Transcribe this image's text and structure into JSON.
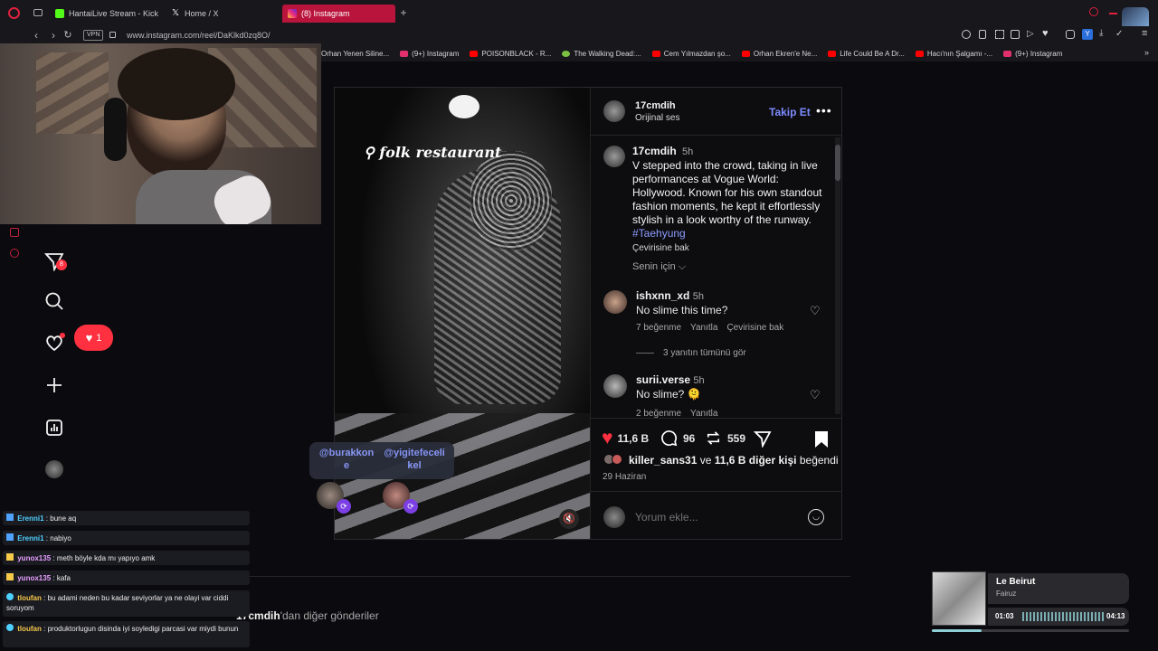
{
  "browser": {
    "tabs": [
      {
        "label": "HantaiLive Stream - Kick.D",
        "icon": "kick-icon",
        "color": "#53fc18"
      },
      {
        "label": "Home / X",
        "icon": "x-icon",
        "color": "#ffffff"
      },
      {
        "label": "(8) Instagram",
        "icon": "instagram-icon",
        "color": "#e1306c",
        "active": true
      }
    ],
    "url": "www.instagram.com/reel/DaKlkd0zq8O/",
    "vpn_label": "VPN",
    "accent": "#b9143c"
  },
  "bookmarks": [
    {
      "label": "Orhan Yenen Siline...",
      "color": ""
    },
    {
      "label": "(9+) Instagram",
      "color": "#e1306c"
    },
    {
      "label": "POISONBLACK - R...",
      "color": "#ff0000"
    },
    {
      "label": "The Walking Dead:...",
      "color": "#7ac143"
    },
    {
      "label": "Cem Yılmazdan şo...",
      "color": "#ff0000"
    },
    {
      "label": "Orhan Ekren'e Ne...",
      "color": "#ff0000"
    },
    {
      "label": "Life Could Be A Dr...",
      "color": "#ff0000"
    },
    {
      "label": "Hacı'nın Şalgamı -...",
      "color": "#ff0000"
    },
    {
      "label": "(9+) Instagram",
      "color": "#e1306c"
    }
  ],
  "sidebar": {
    "notif_badge": "8",
    "like_count": "1"
  },
  "post": {
    "username": "17cmdih",
    "audio": "Orijinal ses",
    "follow_label": "Takip Et",
    "media_caption": "folk restaurant",
    "caption_time": "5h",
    "caption": "V stepped into the crowd, taking in live performances at Vogue World: Hollywood. Known for his own standout fashion moments, he kept it effortlessly stylish in a look worthy of the runway.",
    "hashtag": "#Taehyung",
    "translate": "Çevirisine bak",
    "for_you": "Senin için",
    "comments": [
      {
        "user": "ishxnn_xd",
        "time": "5h",
        "text": "No slime this time?",
        "likes": "7 beğenme",
        "reply": "Yanıtla",
        "translate": "Çevirisine bak",
        "view_replies": "3 yanıtın tümünü gör"
      },
      {
        "user": "surii.verse",
        "time": "5h",
        "text": "No slime? 🫠",
        "likes": "2 beğenme",
        "reply": "Yanıtla"
      }
    ],
    "like_count": "11,6 B",
    "comment_count": "96",
    "repost_count": "559",
    "liked_by_user": "killer_sans31",
    "liked_by_mid": "ve",
    "liked_by_others": "11,6 B diğer kişi",
    "liked_by_suffix": "beğendi",
    "date": "29 Haziran",
    "comment_placeholder": "Yorum ekle...",
    "tags": [
      "@burakkone",
      "@yigitefecelikel"
    ]
  },
  "more_posts": {
    "user": "17cmdih",
    "suffix": "'dan diğer gönderiler"
  },
  "chat": [
    {
      "name": "Erenni1",
      "msg": "bune aq",
      "color": "#4fd1ff"
    },
    {
      "name": "Erenni1",
      "msg": "nabiyo",
      "color": "#4fd1ff"
    },
    {
      "name": "yunox135",
      "msg": "meth böyle kda mı yapıyo amk",
      "color": "#e8a0ff"
    },
    {
      "name": "yunox135",
      "msg": "kafa",
      "color": "#e8a0ff"
    },
    {
      "name": "tloufan",
      "msg": "bu adami neden bu kadar seviyorlar ya ne olayi var ciddi soruyom",
      "color": "#f7c948"
    },
    {
      "name": "tloufan",
      "msg": "produktorlugun disinda iyi soyledigi parcasi var miydi bunun",
      "color": "#f7c948"
    }
  ],
  "music": {
    "title": "Le Beirut",
    "artist": "Fairuz",
    "elapsed": "01:03",
    "duration": "04:13",
    "progress": 0.25
  }
}
